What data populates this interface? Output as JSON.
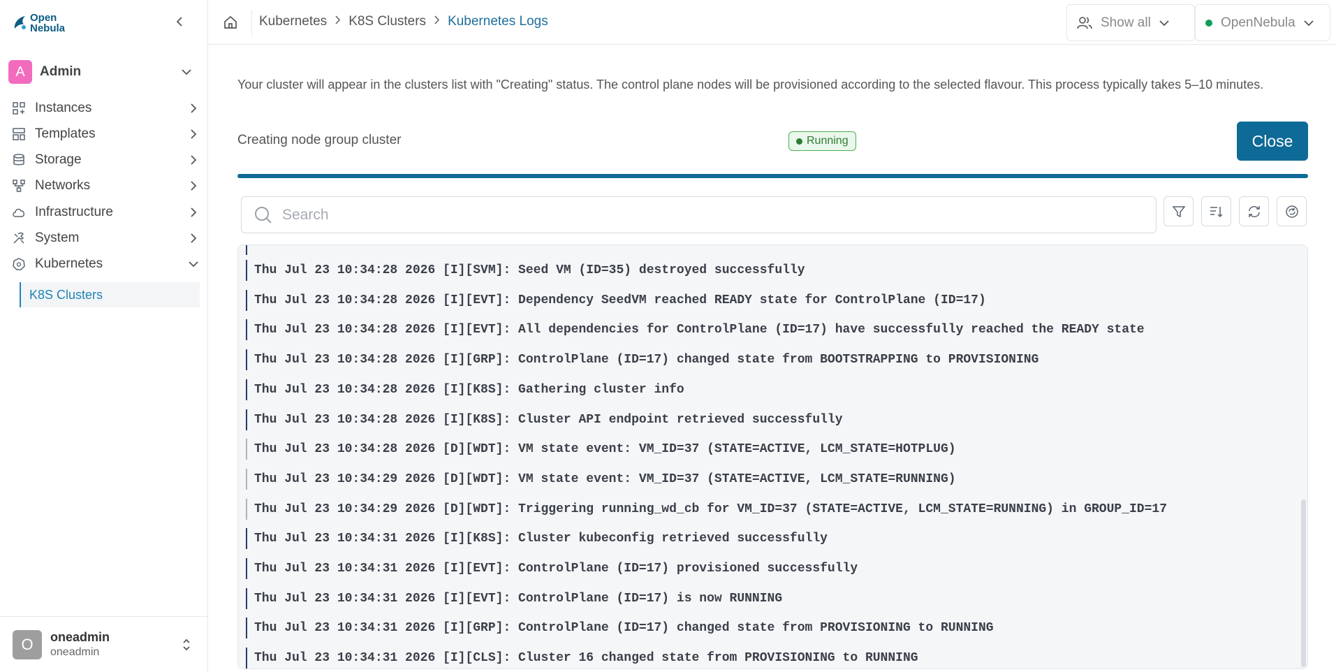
{
  "app": {
    "logo_line1": "Open",
    "logo_line2": "Nebula"
  },
  "sidebar": {
    "group": {
      "avatar_letter": "A",
      "name": "Admin"
    },
    "items": [
      {
        "label": "Instances",
        "icon": "instances-icon"
      },
      {
        "label": "Templates",
        "icon": "templates-icon"
      },
      {
        "label": "Storage",
        "icon": "storage-icon"
      },
      {
        "label": "Networks",
        "icon": "networks-icon"
      },
      {
        "label": "Infrastructure",
        "icon": "infrastructure-icon"
      },
      {
        "label": "System",
        "icon": "system-icon"
      },
      {
        "label": "Kubernetes",
        "icon": "kubernetes-icon"
      }
    ],
    "sub_item": "K8S Clusters",
    "user": {
      "avatar_letter": "O",
      "name": "oneadmin",
      "sub": "oneadmin"
    }
  },
  "header": {
    "breadcrumb": [
      "Kubernetes",
      "K8S Clusters",
      "Kubernetes Logs"
    ],
    "filter_label": "Show all",
    "zone_label": "OpenNebula",
    "zone_status_color": "#0f9d58"
  },
  "main": {
    "info": "Your cluster will appear in the clusters list with \"Creating\" status. The control plane nodes will be provisioned according to the selected flavour. This process typically takes 5–10 minutes.",
    "task_label": "Creating node group cluster",
    "status": "Running",
    "close_label": "Close",
    "progress": 1.0,
    "search_placeholder": "Search",
    "accent_color": "#0e6a96"
  },
  "logs": [
    {
      "text": "Thu Jul 23 10:34:28 2026 [I][SVM]: Seed VM (ID=35) destroyed successfully",
      "level": "I"
    },
    {
      "text": "Thu Jul 23 10:34:28 2026 [I][EVT]: Dependency SeedVM reached READY state for ControlPlane (ID=17)",
      "level": "I"
    },
    {
      "text": "Thu Jul 23 10:34:28 2026 [I][EVT]: All dependencies for ControlPlane (ID=17) have successfully reached the READY state",
      "level": "I"
    },
    {
      "text": "Thu Jul 23 10:34:28 2026 [I][GRP]: ControlPlane (ID=17) changed state from BOOTSTRAPPING to PROVISIONING",
      "level": "I"
    },
    {
      "text": "Thu Jul 23 10:34:28 2026 [I][K8S]: Gathering cluster info",
      "level": "I"
    },
    {
      "text": "Thu Jul 23 10:34:28 2026 [I][K8S]: Cluster API endpoint retrieved successfully",
      "level": "I"
    },
    {
      "text": "Thu Jul 23 10:34:28 2026 [D][WDT]: VM state event: VM_ID=37 (STATE=ACTIVE, LCM_STATE=HOTPLUG)",
      "level": "D"
    },
    {
      "text": "Thu Jul 23 10:34:29 2026 [D][WDT]: VM state event: VM_ID=37 (STATE=ACTIVE, LCM_STATE=RUNNING)",
      "level": "D"
    },
    {
      "text": "Thu Jul 23 10:34:29 2026 [D][WDT]: Triggering running_wd_cb for VM_ID=37 (STATE=ACTIVE, LCM_STATE=RUNNING) in GROUP_ID=17",
      "level": "D"
    },
    {
      "text": "Thu Jul 23 10:34:31 2026 [I][K8S]: Cluster kubeconfig retrieved successfully",
      "level": "I"
    },
    {
      "text": "Thu Jul 23 10:34:31 2026 [I][EVT]: ControlPlane (ID=17) provisioned successfully",
      "level": "I"
    },
    {
      "text": "Thu Jul 23 10:34:31 2026 [I][EVT]: ControlPlane (ID=17) is now RUNNING",
      "level": "I"
    },
    {
      "text": "Thu Jul 23 10:34:31 2026 [I][GRP]: ControlPlane (ID=17) changed state from PROVISIONING to RUNNING",
      "level": "I"
    },
    {
      "text": "Thu Jul 23 10:34:31 2026 [I][CLS]: Cluster 16 changed state from PROVISIONING to RUNNING",
      "level": "I"
    }
  ]
}
